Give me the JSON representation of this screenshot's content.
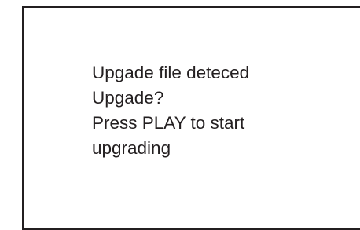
{
  "dialog": {
    "lines": [
      "Upgade file deteced",
      "Upgade?",
      "Press PLAY to start",
      "upgrading"
    ]
  },
  "colors": {
    "text": "#231f20",
    "border": "#231f20",
    "background": "#ffffff"
  }
}
